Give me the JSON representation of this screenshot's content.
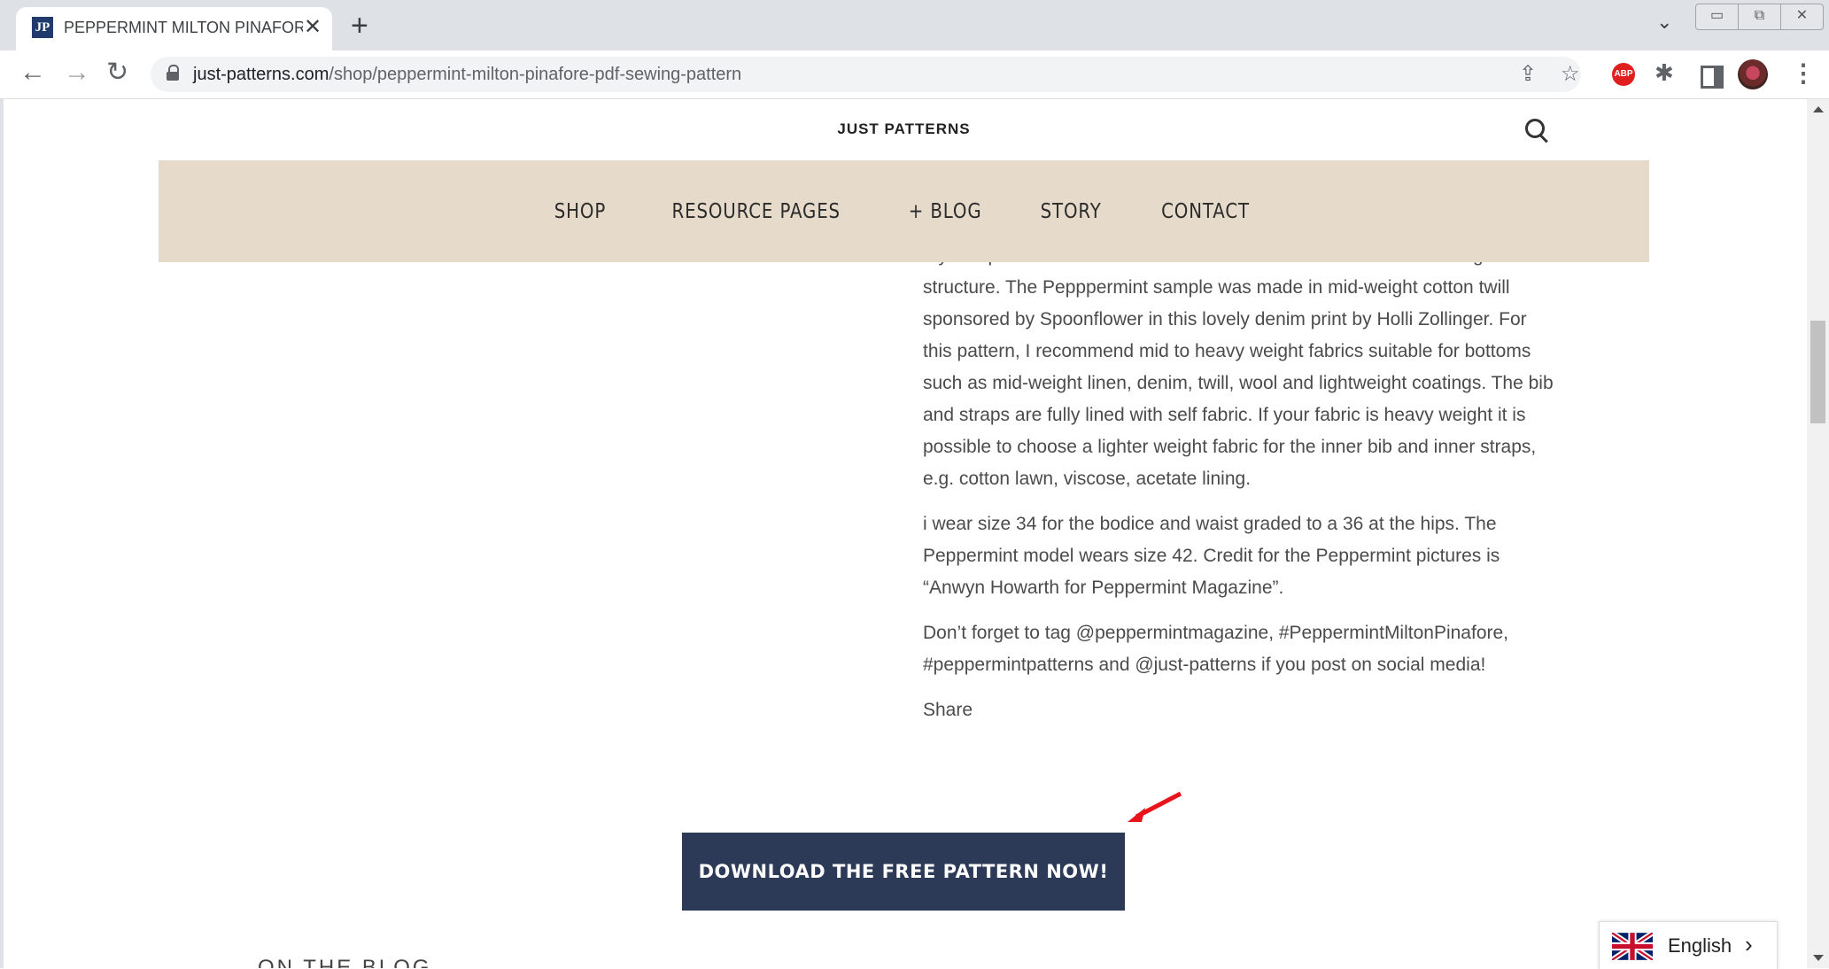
{
  "browser": {
    "tab": {
      "favicon_text": "JP",
      "title": "PEPPERMINT MILTON PINAFORE",
      "close": "✕"
    },
    "new_tab": "+",
    "tab_search": "⌄",
    "window_buttons": [
      "▭",
      "⧉",
      "✕"
    ],
    "nav": {
      "back": "←",
      "forward": "→",
      "reload": "↻"
    },
    "url_host": "just-patterns.com",
    "url_path": "/shop/peppermint-milton-pinafore-pdf-sewing-pattern",
    "share_icon": "⇪",
    "star_icon": "☆",
    "abp_label": "ABP",
    "puzzle_icon": "✱",
    "menu_icon": "⋮"
  },
  "site": {
    "title": "JUST PATTERNS",
    "nav": [
      "SHOP",
      "RESOURCE PAGES",
      "+ BLOG",
      "STORY",
      "CONTACT"
    ],
    "colors": {
      "nav_bg": "#e6dbca",
      "button_bg": "#2c3a57"
    }
  },
  "article": {
    "para1": "My sample is cut in a brown wool/viscose blend that has a nice weight and structure. The Pepppermint sample was made in mid-weight cotton twill sponsored by Spoonflower in this lovely denim print by Holli Zollinger. For this pattern, I recommend mid to heavy weight fabrics suitable for bottoms such as mid-weight linen, denim, twill, wool and lightweight coatings. The bib and straps are fully lined with self fabric. If your fabric is heavy weight it is possible to choose a lighter weight fabric for the inner bib and inner straps, e.g. cotton lawn, viscose, acetate lining.",
    "para2": "i wear size 34 for the bodice and waist graded to a 36 at the hips. The Peppermint model wears size 42. Credit for the Peppermint pictures is “Anwyn Howarth for Peppermint Magazine”.",
    "para3": "Don’t forget to tag @peppermintmagazine, #PeppermintMiltonPinafore, #peppermintpatterns and @just-patterns if you post on social media!",
    "share": "Share",
    "download_button": "DOWNLOAD THE FREE PATTERN NOW!",
    "on_the_blog": "ON THE BLOG"
  },
  "language": {
    "label": "English",
    "chevron": "›"
  }
}
